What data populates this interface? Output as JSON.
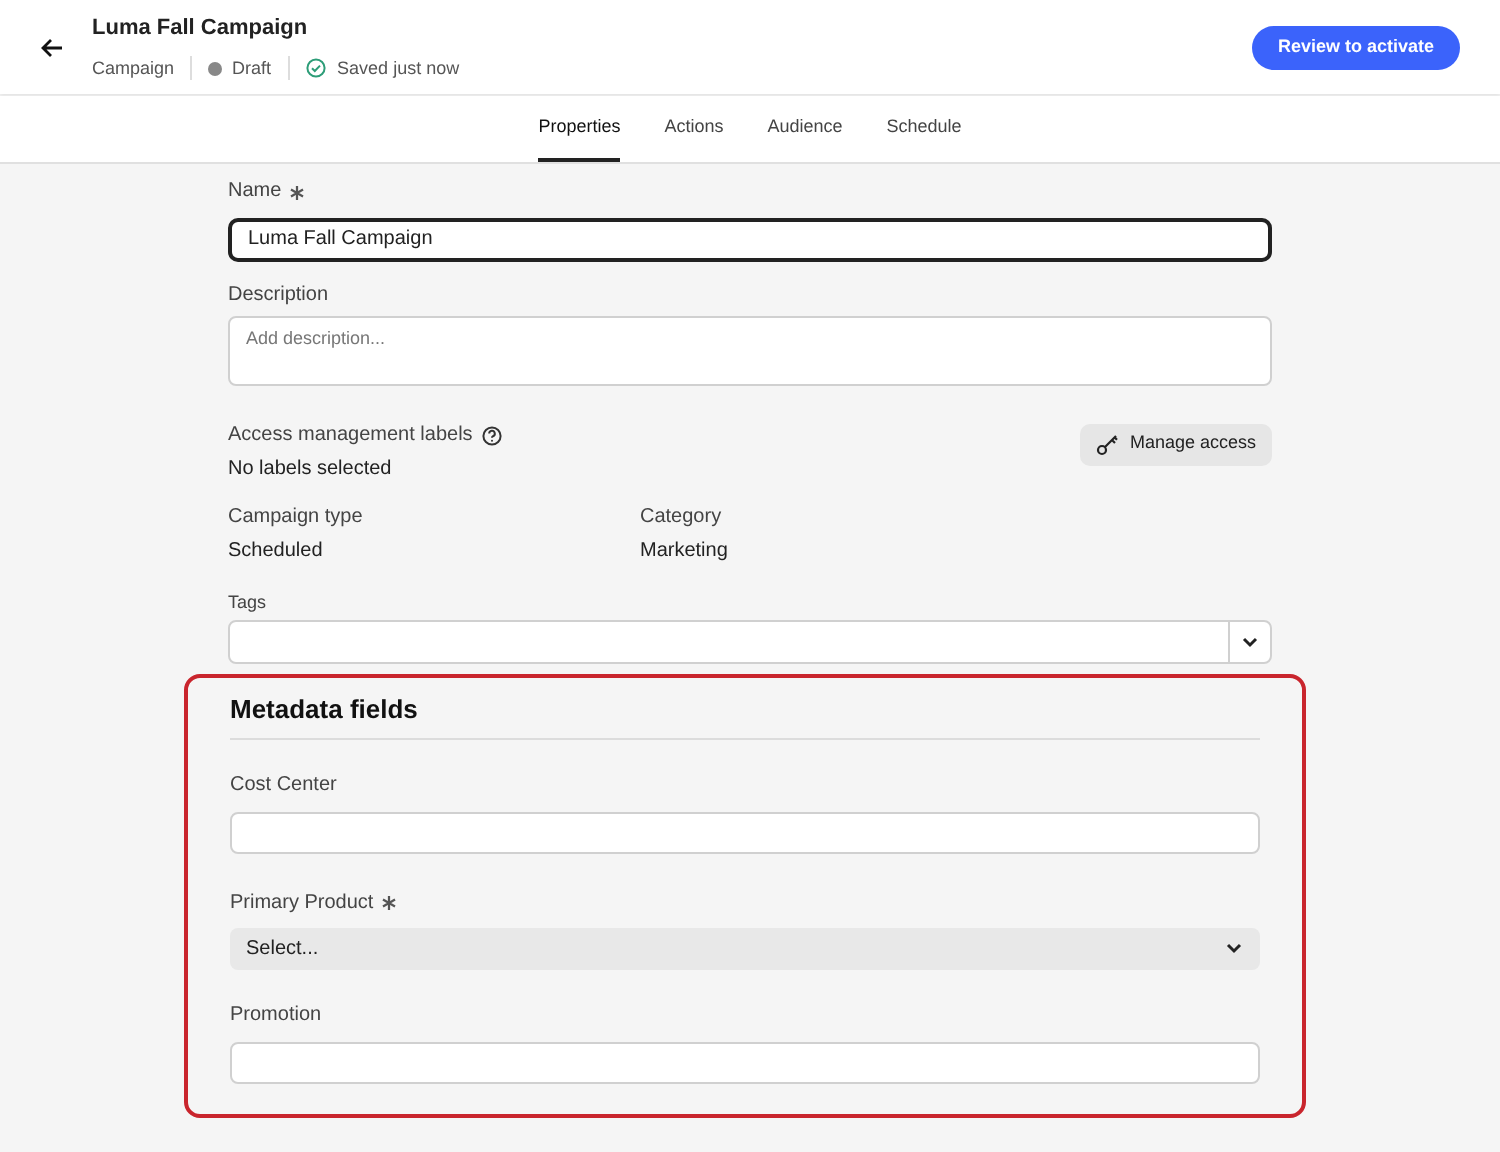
{
  "header": {
    "title": "Luma Fall Campaign",
    "type": "Campaign",
    "status": "Draft",
    "saved": "Saved just now",
    "primary_button": "Review to activate"
  },
  "tabs": [
    {
      "label": "Properties",
      "selected": true
    },
    {
      "label": "Actions",
      "selected": false
    },
    {
      "label": "Audience",
      "selected": false
    },
    {
      "label": "Schedule",
      "selected": false
    }
  ],
  "name_field": {
    "label": "Name",
    "required": true,
    "value": "Luma Fall Campaign"
  },
  "description_field": {
    "label": "Description",
    "placeholder": "Add description..."
  },
  "access": {
    "label": "Access management labels",
    "value": "No labels selected",
    "button": "Manage access"
  },
  "info": [
    {
      "label": "Campaign type",
      "value": "Scheduled"
    },
    {
      "label": "Category",
      "value": "Marketing"
    }
  ],
  "tags_field": {
    "label": "Tags"
  },
  "metadata": {
    "title": "Metadata fields",
    "fields": [
      {
        "kind": "text",
        "label": "Cost Center",
        "required": false
      },
      {
        "kind": "select",
        "label": "Primary Product",
        "required": true,
        "placeholder": "Select..."
      },
      {
        "kind": "text",
        "label": "Promotion",
        "required": false
      }
    ]
  }
}
